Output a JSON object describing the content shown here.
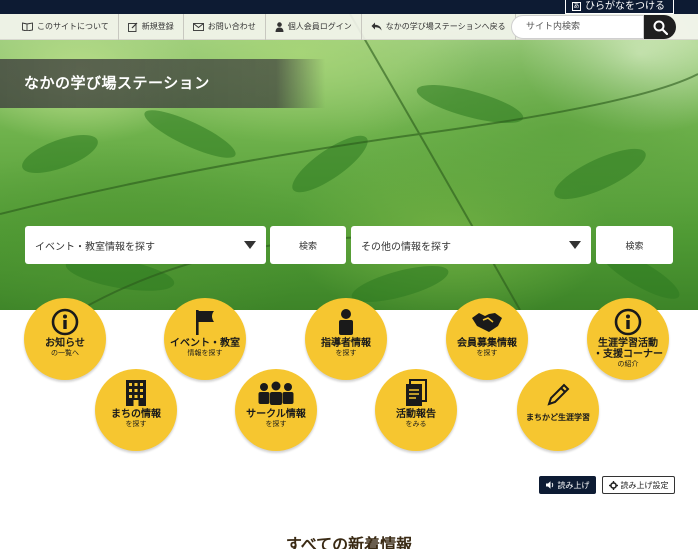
{
  "topbar": {
    "furigana_label": "ひらがなをつける"
  },
  "utilnav": {
    "items": [
      {
        "label": "このサイトについて",
        "icon": "book-icon"
      },
      {
        "label": "新規登録",
        "icon": "edit-icon"
      },
      {
        "label": "お問い合わせ",
        "icon": "mail-icon"
      },
      {
        "label": "個人会員ログイン",
        "icon": "person-icon"
      },
      {
        "label": "なかの学び場ステーションへ戻る",
        "icon": "back-arrow-icon"
      }
    ],
    "search_placeholder": "サイト内検索"
  },
  "site": {
    "title": "なかの学び場ステーション"
  },
  "search": {
    "select1": "イベント・教室情報を探す",
    "button1": "検索",
    "select2": "その他の情報を探す",
    "button2": "検索"
  },
  "categories": [
    {
      "main": "お知らせ",
      "sub": "の一覧へ",
      "icon": "info-icon"
    },
    {
      "main": "イベント・教室",
      "sub": "情報を探す",
      "icon": "flag-icon"
    },
    {
      "main": "指導者情報",
      "sub": "を探す",
      "icon": "instructor-icon"
    },
    {
      "main": "会員募集情報",
      "sub": "を探す",
      "icon": "handshake-icon"
    },
    {
      "main": "生涯学習活動\n・支援コーナー",
      "sub": "の紹介",
      "icon": "info-icon"
    },
    {
      "main": "まちの情報",
      "sub": "を探す",
      "icon": "building-icon"
    },
    {
      "main": "サークル情報",
      "sub": "を探す",
      "icon": "group-icon"
    },
    {
      "main": "活動報告",
      "sub": "をみる",
      "icon": "document-icon"
    },
    {
      "main": "",
      "sub": "まちかど生涯学習",
      "icon": "pencil-icon"
    }
  ],
  "read_aloud": {
    "read_label": "読み上げ",
    "settings_label": "読み上げ設定"
  },
  "news": {
    "heading": "すべての新着情報"
  },
  "colors": {
    "accent_yellow": "#f6c630",
    "navy": "#0d1b33"
  }
}
